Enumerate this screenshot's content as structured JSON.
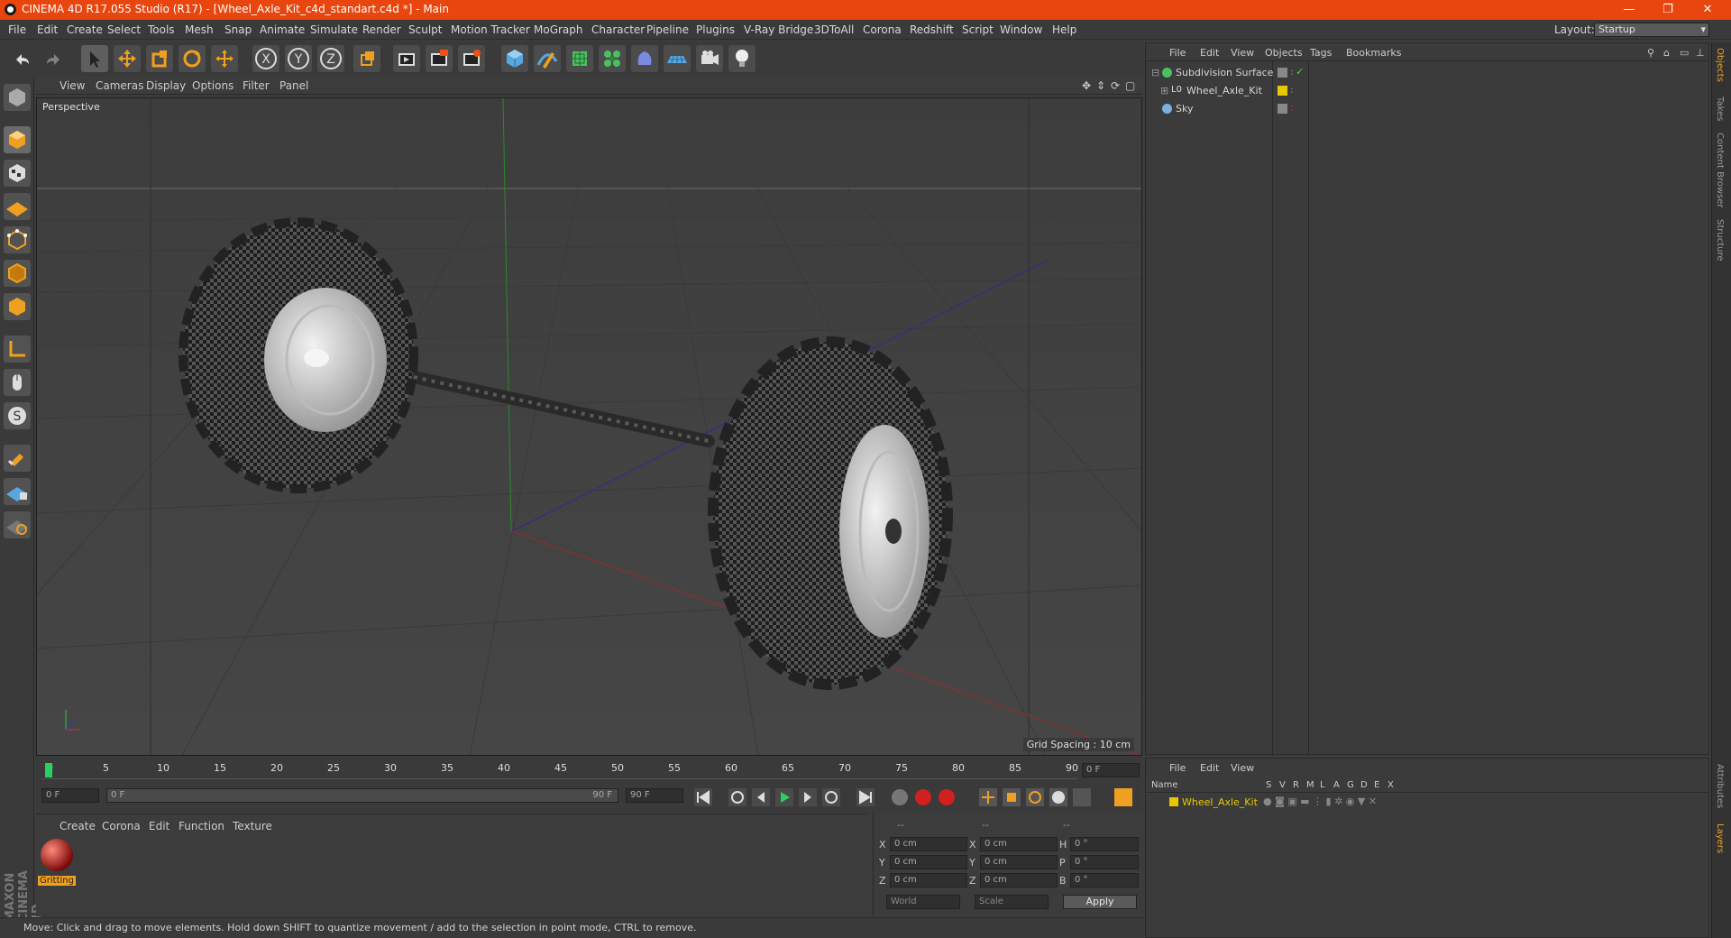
{
  "window": {
    "title": "CINEMA 4D R17.055 Studio (R17) - [Wheel_Axle_Kit_c4d_standart.c4d *] - Main"
  },
  "menubar": {
    "items": [
      "File",
      "Edit",
      "Create",
      "Select",
      "Tools",
      "Mesh",
      "Snap",
      "Animate",
      "Simulate",
      "Render",
      "Sculpt",
      "Motion Tracker",
      "MoGraph",
      "Character",
      "Pipeline",
      "Plugins",
      "V-Ray Bridge",
      "3DToAll",
      "Corona",
      "Redshift",
      "Script",
      "Window",
      "Help"
    ],
    "layout_label": "Layout:",
    "layout_value": "Startup"
  },
  "toolbar": {
    "icons": [
      "undo-icon",
      "redo-icon",
      "select-arrow-icon",
      "move-icon",
      "scale-icon",
      "rotate-icon",
      "move-alt-icon",
      "x-axis-icon",
      "y-axis-icon",
      "z-axis-icon",
      "coordinate-system-icon",
      "render-view-icon",
      "render-picture-viewer-icon",
      "edit-render-settings-icon",
      "cube-icon",
      "pen-spline-icon",
      "subdivision-surface-icon",
      "cloner-icon",
      "deformer-icon",
      "floor-icon",
      "camera-icon",
      "light-icon"
    ]
  },
  "viewport": {
    "menu": [
      "View",
      "Cameras",
      "Display",
      "Options",
      "Filter",
      "Panel"
    ],
    "label": "Perspective",
    "grid_spacing": "Grid Spacing : 10 cm"
  },
  "timeline": {
    "ticks": [
      "0",
      "5",
      "10",
      "15",
      "20",
      "25",
      "30",
      "35",
      "40",
      "45",
      "50",
      "55",
      "60",
      "65",
      "70",
      "75",
      "80",
      "85",
      "90"
    ],
    "current_frame": "0 F",
    "start_field": "0 F",
    "range_start": "0 F",
    "range_end": "90 F",
    "end_field": "90 F"
  },
  "material_manager": {
    "menu": [
      "Create",
      "Corona",
      "Edit",
      "Function",
      "Texture"
    ],
    "material_name": "Gritting"
  },
  "coordinates": {
    "headers": [
      "--",
      "--",
      "--"
    ],
    "rows": [
      {
        "a": "X",
        "av": "0 cm",
        "b": "X",
        "bv": "0 cm",
        "c": "H",
        "cv": "0 °"
      },
      {
        "a": "Y",
        "av": "0 cm",
        "b": "Y",
        "bv": "0 cm",
        "c": "P",
        "cv": "0 °"
      },
      {
        "a": "Z",
        "av": "0 cm",
        "b": "Z",
        "bv": "0 cm",
        "c": "B",
        "cv": "0 °"
      }
    ],
    "mode1": "World",
    "mode2": "Scale",
    "apply": "Apply"
  },
  "object_manager": {
    "menu": [
      "File",
      "Edit",
      "View",
      "Objects",
      "Tags",
      "Bookmarks"
    ],
    "objects": [
      {
        "name": "Subdivision Surface",
        "icon": "subdivision-surface-icon"
      },
      {
        "name": "Wheel_Axle_Kit",
        "icon": "null-object-icon"
      },
      {
        "name": "Sky",
        "icon": "sky-icon"
      }
    ]
  },
  "layer_manager": {
    "menu": [
      "File",
      "Edit",
      "View"
    ],
    "columns": [
      "Name",
      "S",
      "V",
      "R",
      "M",
      "L",
      "A",
      "G",
      "D",
      "E",
      "X"
    ],
    "layers": [
      {
        "name": "Wheel_Axle_Kit",
        "color": "#e8c800"
      }
    ]
  },
  "right_tabs": [
    "Objects",
    "Takes",
    "Content Browser",
    "Structure",
    "Attributes",
    "Layers"
  ],
  "branding": "MAXON CINEMA 4D",
  "status": "Move: Click and drag to move elements. Hold down SHIFT to quantize movement / add to the selection in point mode, CTRL to remove."
}
